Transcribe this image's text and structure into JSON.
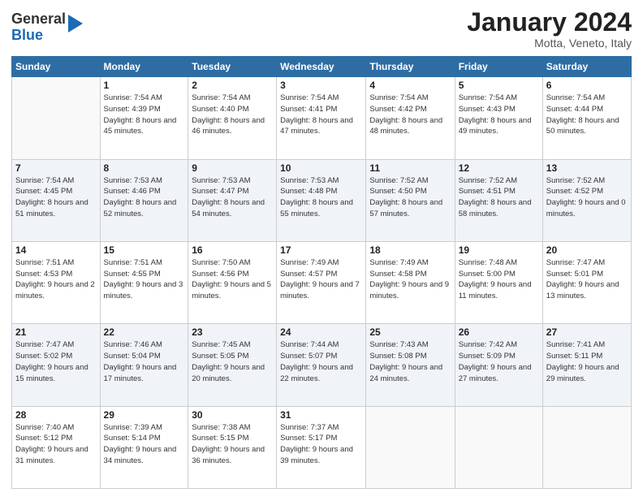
{
  "header": {
    "logo_general": "General",
    "logo_blue": "Blue",
    "month_title": "January 2024",
    "location": "Motta, Veneto, Italy"
  },
  "days_of_week": [
    "Sunday",
    "Monday",
    "Tuesday",
    "Wednesday",
    "Thursday",
    "Friday",
    "Saturday"
  ],
  "weeks": [
    [
      {
        "day": "",
        "sunrise": "",
        "sunset": "",
        "daylight": ""
      },
      {
        "day": "1",
        "sunrise": "Sunrise: 7:54 AM",
        "sunset": "Sunset: 4:39 PM",
        "daylight": "Daylight: 8 hours and 45 minutes."
      },
      {
        "day": "2",
        "sunrise": "Sunrise: 7:54 AM",
        "sunset": "Sunset: 4:40 PM",
        "daylight": "Daylight: 8 hours and 46 minutes."
      },
      {
        "day": "3",
        "sunrise": "Sunrise: 7:54 AM",
        "sunset": "Sunset: 4:41 PM",
        "daylight": "Daylight: 8 hours and 47 minutes."
      },
      {
        "day": "4",
        "sunrise": "Sunrise: 7:54 AM",
        "sunset": "Sunset: 4:42 PM",
        "daylight": "Daylight: 8 hours and 48 minutes."
      },
      {
        "day": "5",
        "sunrise": "Sunrise: 7:54 AM",
        "sunset": "Sunset: 4:43 PM",
        "daylight": "Daylight: 8 hours and 49 minutes."
      },
      {
        "day": "6",
        "sunrise": "Sunrise: 7:54 AM",
        "sunset": "Sunset: 4:44 PM",
        "daylight": "Daylight: 8 hours and 50 minutes."
      }
    ],
    [
      {
        "day": "7",
        "sunrise": "Sunrise: 7:54 AM",
        "sunset": "Sunset: 4:45 PM",
        "daylight": "Daylight: 8 hours and 51 minutes."
      },
      {
        "day": "8",
        "sunrise": "Sunrise: 7:53 AM",
        "sunset": "Sunset: 4:46 PM",
        "daylight": "Daylight: 8 hours and 52 minutes."
      },
      {
        "day": "9",
        "sunrise": "Sunrise: 7:53 AM",
        "sunset": "Sunset: 4:47 PM",
        "daylight": "Daylight: 8 hours and 54 minutes."
      },
      {
        "day": "10",
        "sunrise": "Sunrise: 7:53 AM",
        "sunset": "Sunset: 4:48 PM",
        "daylight": "Daylight: 8 hours and 55 minutes."
      },
      {
        "day": "11",
        "sunrise": "Sunrise: 7:52 AM",
        "sunset": "Sunset: 4:50 PM",
        "daylight": "Daylight: 8 hours and 57 minutes."
      },
      {
        "day": "12",
        "sunrise": "Sunrise: 7:52 AM",
        "sunset": "Sunset: 4:51 PM",
        "daylight": "Daylight: 8 hours and 58 minutes."
      },
      {
        "day": "13",
        "sunrise": "Sunrise: 7:52 AM",
        "sunset": "Sunset: 4:52 PM",
        "daylight": "Daylight: 9 hours and 0 minutes."
      }
    ],
    [
      {
        "day": "14",
        "sunrise": "Sunrise: 7:51 AM",
        "sunset": "Sunset: 4:53 PM",
        "daylight": "Daylight: 9 hours and 2 minutes."
      },
      {
        "day": "15",
        "sunrise": "Sunrise: 7:51 AM",
        "sunset": "Sunset: 4:55 PM",
        "daylight": "Daylight: 9 hours and 3 minutes."
      },
      {
        "day": "16",
        "sunrise": "Sunrise: 7:50 AM",
        "sunset": "Sunset: 4:56 PM",
        "daylight": "Daylight: 9 hours and 5 minutes."
      },
      {
        "day": "17",
        "sunrise": "Sunrise: 7:49 AM",
        "sunset": "Sunset: 4:57 PM",
        "daylight": "Daylight: 9 hours and 7 minutes."
      },
      {
        "day": "18",
        "sunrise": "Sunrise: 7:49 AM",
        "sunset": "Sunset: 4:58 PM",
        "daylight": "Daylight: 9 hours and 9 minutes."
      },
      {
        "day": "19",
        "sunrise": "Sunrise: 7:48 AM",
        "sunset": "Sunset: 5:00 PM",
        "daylight": "Daylight: 9 hours and 11 minutes."
      },
      {
        "day": "20",
        "sunrise": "Sunrise: 7:47 AM",
        "sunset": "Sunset: 5:01 PM",
        "daylight": "Daylight: 9 hours and 13 minutes."
      }
    ],
    [
      {
        "day": "21",
        "sunrise": "Sunrise: 7:47 AM",
        "sunset": "Sunset: 5:02 PM",
        "daylight": "Daylight: 9 hours and 15 minutes."
      },
      {
        "day": "22",
        "sunrise": "Sunrise: 7:46 AM",
        "sunset": "Sunset: 5:04 PM",
        "daylight": "Daylight: 9 hours and 17 minutes."
      },
      {
        "day": "23",
        "sunrise": "Sunrise: 7:45 AM",
        "sunset": "Sunset: 5:05 PM",
        "daylight": "Daylight: 9 hours and 20 minutes."
      },
      {
        "day": "24",
        "sunrise": "Sunrise: 7:44 AM",
        "sunset": "Sunset: 5:07 PM",
        "daylight": "Daylight: 9 hours and 22 minutes."
      },
      {
        "day": "25",
        "sunrise": "Sunrise: 7:43 AM",
        "sunset": "Sunset: 5:08 PM",
        "daylight": "Daylight: 9 hours and 24 minutes."
      },
      {
        "day": "26",
        "sunrise": "Sunrise: 7:42 AM",
        "sunset": "Sunset: 5:09 PM",
        "daylight": "Daylight: 9 hours and 27 minutes."
      },
      {
        "day": "27",
        "sunrise": "Sunrise: 7:41 AM",
        "sunset": "Sunset: 5:11 PM",
        "daylight": "Daylight: 9 hours and 29 minutes."
      }
    ],
    [
      {
        "day": "28",
        "sunrise": "Sunrise: 7:40 AM",
        "sunset": "Sunset: 5:12 PM",
        "daylight": "Daylight: 9 hours and 31 minutes."
      },
      {
        "day": "29",
        "sunrise": "Sunrise: 7:39 AM",
        "sunset": "Sunset: 5:14 PM",
        "daylight": "Daylight: 9 hours and 34 minutes."
      },
      {
        "day": "30",
        "sunrise": "Sunrise: 7:38 AM",
        "sunset": "Sunset: 5:15 PM",
        "daylight": "Daylight: 9 hours and 36 minutes."
      },
      {
        "day": "31",
        "sunrise": "Sunrise: 7:37 AM",
        "sunset": "Sunset: 5:17 PM",
        "daylight": "Daylight: 9 hours and 39 minutes."
      },
      {
        "day": "",
        "sunrise": "",
        "sunset": "",
        "daylight": ""
      },
      {
        "day": "",
        "sunrise": "",
        "sunset": "",
        "daylight": ""
      },
      {
        "day": "",
        "sunrise": "",
        "sunset": "",
        "daylight": ""
      }
    ]
  ]
}
